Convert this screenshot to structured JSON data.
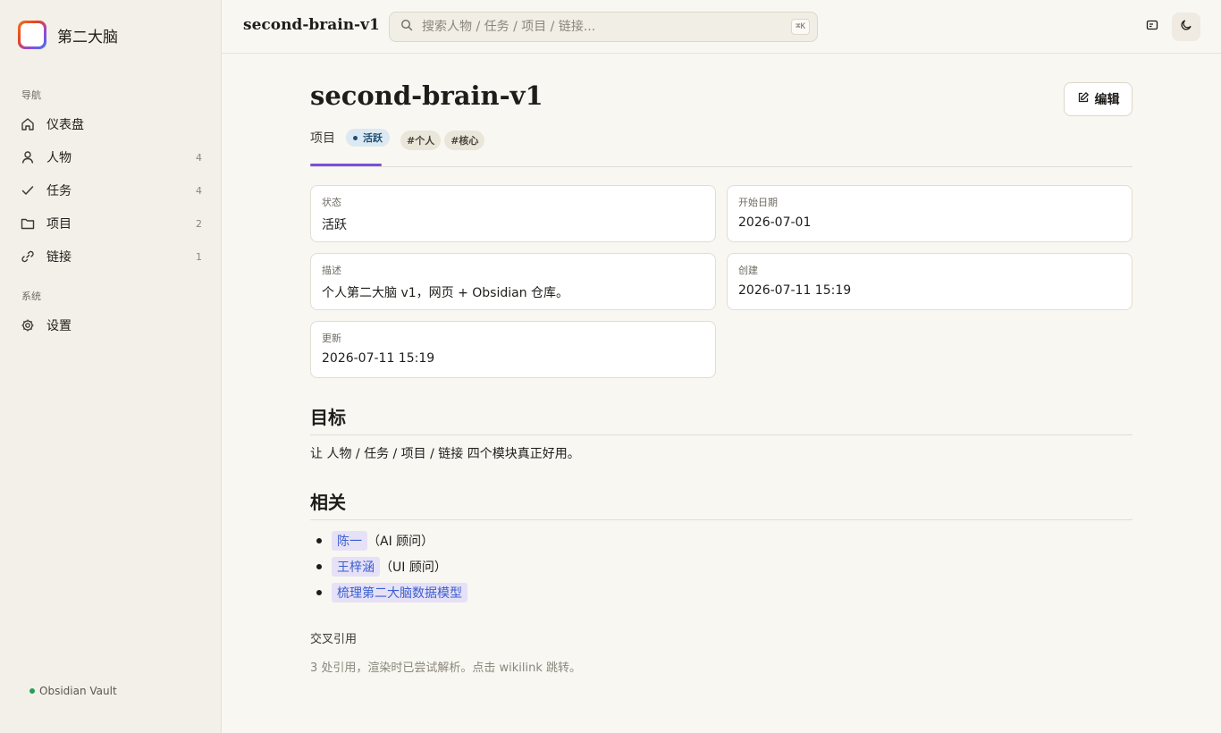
{
  "app": {
    "name": "第二大脑"
  },
  "sidebar": {
    "nav_section": "导航",
    "items": [
      {
        "label": "仪表盘",
        "icon": "home-icon",
        "count": ""
      },
      {
        "label": "人物",
        "icon": "person-icon",
        "count": "4"
      },
      {
        "label": "任务",
        "icon": "check-icon",
        "count": "4"
      },
      {
        "label": "项目",
        "icon": "folder-icon",
        "count": "2"
      },
      {
        "label": "链接",
        "icon": "link-icon",
        "count": "1"
      }
    ],
    "system_section": "系统",
    "settings_label": "设置",
    "vault_label": "Obsidian Vault"
  },
  "topbar": {
    "title": "second-brain-v1",
    "search_placeholder": "搜索人物 / 任务 / 项目 / 链接...",
    "shortcut": "⌘K"
  },
  "page": {
    "title": "second-brain-v1",
    "edit_label": "编辑",
    "type": "项目",
    "status": "活跃",
    "tags": [
      "#个人",
      "#核心"
    ]
  },
  "fields": [
    {
      "label": "状态",
      "value": "活跃"
    },
    {
      "label": "开始日期",
      "value": "2026-07-01"
    },
    {
      "label": "描述",
      "value": "个人第二大脑 v1，网页 + Obsidian 仓库。"
    },
    {
      "label": "创建",
      "value": "2026-07-11 15:19"
    },
    {
      "label": "更新",
      "value": "2026-07-11 15:19"
    }
  ],
  "goal": {
    "heading": "目标",
    "text": "让 人物 / 任务 / 项目 / 链接 四个模块真正好用。"
  },
  "related": {
    "heading": "相关",
    "items": [
      {
        "link": "陈一",
        "note": "（AI 顾问）"
      },
      {
        "link": "王梓涵",
        "note": "（UI 顾问）"
      },
      {
        "link": "梳理第二大脑数据模型",
        "note": ""
      }
    ]
  },
  "xref": {
    "title": "交叉引用",
    "note": "3 处引用，渲染时已尝试解析。点击 wikilink 跳转。"
  },
  "colors": {
    "accent": "#7b4ee0",
    "status_bg": "#dde9f2",
    "link": "#3a5fd0",
    "vault_dot": "#22a05a"
  }
}
